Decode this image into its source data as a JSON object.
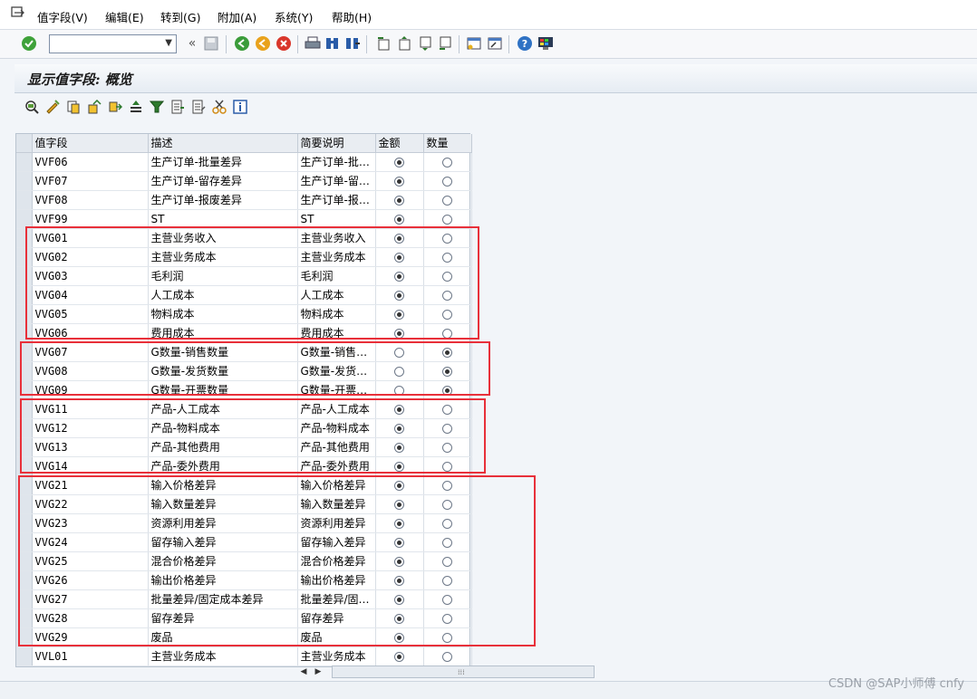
{
  "menubar": {
    "items": [
      "值字段(V)",
      "编辑(E)",
      "转到(G)",
      "附加(A)",
      "系统(Y)",
      "帮助(H)"
    ]
  },
  "toolbar": {
    "command_value": "",
    "icons": [
      "enter-icon",
      "save-icon",
      "back-icon",
      "exit-icon",
      "cancel-icon",
      "print-icon",
      "find-icon",
      "find-next-icon",
      "first-page-icon",
      "prev-page-icon",
      "next-page-icon",
      "last-page-icon",
      "new-session-icon",
      "shortcut-icon",
      "help-icon",
      "customize-layout-icon"
    ]
  },
  "page": {
    "title": "显示值字段: 概览"
  },
  "app_toolbar": {
    "icons": [
      "display-change-icon",
      "edit-icon",
      "copy-icon",
      "copy-as-icon",
      "move-icon",
      "sort-ascending-icon",
      "filter-icon",
      "select-all-icon",
      "deselect-all-icon",
      "cut-icon",
      "info-icon"
    ]
  },
  "table": {
    "columns": [
      "值字段",
      "描述",
      "简要说明",
      "金额",
      "数量"
    ],
    "rows": [
      {
        "code": "VVF06",
        "desc": "生产订单-批量差异",
        "short": "生产订单-批量…",
        "amount": true,
        "qty": false
      },
      {
        "code": "VVF07",
        "desc": "生产订单-留存差异",
        "short": "生产订单-留存…",
        "amount": true,
        "qty": false
      },
      {
        "code": "VVF08",
        "desc": "生产订单-报废差异",
        "short": "生产订单-报废…",
        "amount": true,
        "qty": false
      },
      {
        "code": "VVF99",
        "desc": "ST",
        "short": "ST",
        "amount": true,
        "qty": false
      },
      {
        "code": "VVG01",
        "desc": "主营业务收入",
        "short": "主营业务收入",
        "amount": true,
        "qty": false
      },
      {
        "code": "VVG02",
        "desc": "主营业务成本",
        "short": "主营业务成本",
        "amount": true,
        "qty": false
      },
      {
        "code": "VVG03",
        "desc": "毛利润",
        "short": "毛利润",
        "amount": true,
        "qty": false
      },
      {
        "code": "VVG04",
        "desc": "人工成本",
        "short": "人工成本",
        "amount": true,
        "qty": false
      },
      {
        "code": "VVG05",
        "desc": "物料成本",
        "short": "物料成本",
        "amount": true,
        "qty": false
      },
      {
        "code": "VVG06",
        "desc": "费用成本",
        "short": "费用成本",
        "amount": true,
        "qty": false
      },
      {
        "code": "VVG07",
        "desc": "G数量-销售数量",
        "short": "G数量-销售数量",
        "amount": false,
        "qty": true
      },
      {
        "code": "VVG08",
        "desc": "G数量-发货数量",
        "short": "G数量-发货数量",
        "amount": false,
        "qty": true
      },
      {
        "code": "VVG09",
        "desc": "G数量-开票数量",
        "short": "G数量-开票数量",
        "amount": false,
        "qty": true
      },
      {
        "code": "VVG11",
        "desc": "产品-人工成本",
        "short": "产品-人工成本",
        "amount": true,
        "qty": false
      },
      {
        "code": "VVG12",
        "desc": "产品-物料成本",
        "short": "产品-物料成本",
        "amount": true,
        "qty": false
      },
      {
        "code": "VVG13",
        "desc": "产品-其他费用",
        "short": "产品-其他费用",
        "amount": true,
        "qty": false
      },
      {
        "code": "VVG14",
        "desc": "产品-委外费用",
        "short": "产品-委外费用",
        "amount": true,
        "qty": false
      },
      {
        "code": "VVG21",
        "desc": "输入价格差异",
        "short": "输入价格差异",
        "amount": true,
        "qty": false
      },
      {
        "code": "VVG22",
        "desc": "输入数量差异",
        "short": "输入数量差异",
        "amount": true,
        "qty": false
      },
      {
        "code": "VVG23",
        "desc": "资源利用差异",
        "short": "资源利用差异",
        "amount": true,
        "qty": false
      },
      {
        "code": "VVG24",
        "desc": "留存输入差异",
        "short": "留存输入差异",
        "amount": true,
        "qty": false
      },
      {
        "code": "VVG25",
        "desc": "混合价格差异",
        "short": "混合价格差异",
        "amount": true,
        "qty": false
      },
      {
        "code": "VVG26",
        "desc": "输出价格差异",
        "short": "输出价格差异",
        "amount": true,
        "qty": false
      },
      {
        "code": "VVG27",
        "desc": "批量差异/固定成本差异",
        "short": "批量差异/固定…",
        "amount": true,
        "qty": false
      },
      {
        "code": "VVG28",
        "desc": "留存差异",
        "short": "留存差异",
        "amount": true,
        "qty": false
      },
      {
        "code": "VVG29",
        "desc": "废品",
        "short": "废品",
        "amount": true,
        "qty": false
      },
      {
        "code": "VVL01",
        "desc": "主营业务成本",
        "short": "主营业务成本",
        "amount": true,
        "qty": false
      }
    ]
  },
  "highlight_color": "#e8303a",
  "watermark": "CSDN @SAP小师傅 cnfy"
}
